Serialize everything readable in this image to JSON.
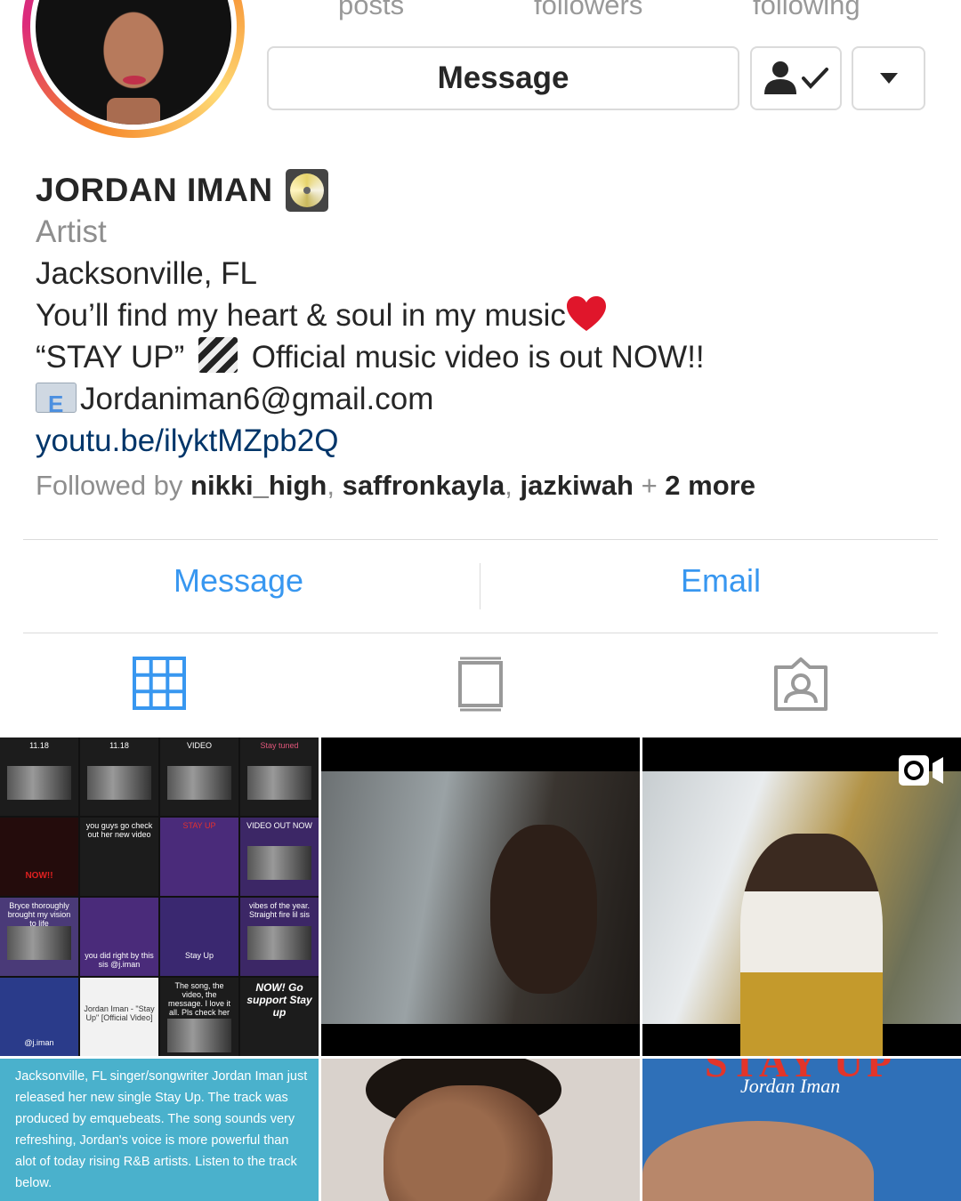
{
  "profile": {
    "stats": [
      {
        "label": "posts"
      },
      {
        "label": "followers"
      },
      {
        "label": "following"
      }
    ],
    "message_button": "Message",
    "name": "JORDAN IMAN",
    "category": "Artist",
    "location": "Jacksonville, FL",
    "bio_line1": "You’ll find my heart & soul in my music",
    "bio_line2_a": "“STAY UP”",
    "bio_line2_b": "Official music video is out NOW!!",
    "email": "Jordaniman6@gmail.com",
    "link": "youtu.be/ilyktMZpb2Q",
    "followed_by_prefix": "Followed by ",
    "followers": [
      "nikki_high",
      "saffronkayla",
      "jazkiwah"
    ],
    "followed_by_more": "2 more"
  },
  "contact": {
    "message_label": "Message",
    "email_label": "Email"
  },
  "tabs": [
    "grid-icon",
    "igtv-icon",
    "tagged-icon"
  ],
  "posts": {
    "collage": [
      "11.18",
      "11.18",
      "VIDEO",
      "Stay tuned",
      "NOW!!",
      "you guys go check out her new video",
      "STAY UP",
      "VIDEO OUT NOW",
      "Bryce thoroughly brought my vision to life",
      "you did right by this sis @j.iman",
      "Stay Up",
      "vibes of the year. Straight fire lil sis",
      "@j.iman",
      "Jordan Iman - \"Stay Up\" [Official Video]",
      "The song, the video, the message. I love it all. Pls check her out.",
      "NOW! Go support Stay up"
    ],
    "article": "Jacksonville, FL singer/songwriter Jordan Iman just released her new single Stay Up. The track was produced by emquebeats. The song sounds very refreshing, Jordan's voice is more powerful than alot of today rising R&B artists. Listen to the track below.",
    "cover_title": "STAY UP",
    "cover_artist": "Jordan Iman"
  },
  "colors": {
    "link_blue": "#3897f0",
    "url_blue": "#003569",
    "secondary_gray": "#8e8e8e",
    "border_gray": "#dbdbdb",
    "article_bg": "#4ab1cc"
  }
}
